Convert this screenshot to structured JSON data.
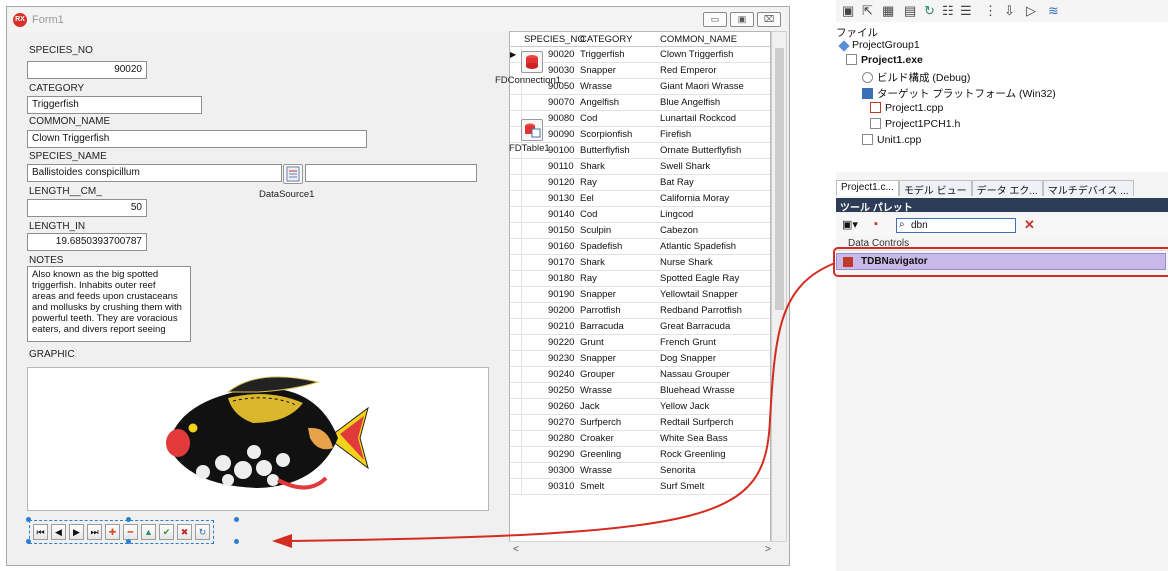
{
  "form": {
    "title": "Form1",
    "app_icon_text": "RX",
    "window_buttons": {
      "minimize": "▭",
      "maximize": "▣",
      "close": "⌧"
    },
    "fields": {
      "species_no": {
        "label": "SPECIES_NO",
        "value": "90020"
      },
      "category": {
        "label": "CATEGORY",
        "value": "Triggerfish"
      },
      "common_name": {
        "label": "COMMON_NAME",
        "value": "Clown Triggerfish"
      },
      "species_name": {
        "label": "SPECIES_NAME",
        "value": "Ballistoides conspicillum"
      },
      "length_cm": {
        "label": "LENGTH__CM_",
        "value": "50"
      },
      "length_in": {
        "label": "LENGTH_IN",
        "value": "19.6850393700787"
      },
      "notes": {
        "label": "NOTES",
        "value": "Also known as the big spotted\ntriggerfish.  Inhabits outer reef\nareas and feeds upon crustaceans\nand mollusks by crushing them with\npowerful teeth.  They are voracious\neaters, and divers report seeing"
      },
      "graphic": {
        "label": "GRAPHIC"
      }
    },
    "components": {
      "datasource": "DataSource1",
      "connection": "FDConnection1",
      "table": "FDTable1"
    },
    "navigator_buttons": [
      "⏮",
      "◀",
      "▶",
      "⏭",
      "✚",
      "━",
      "▲",
      "✔",
      "✖",
      "↻"
    ],
    "grid": {
      "columns": [
        "SPECIES_NO",
        "CATEGORY",
        "COMMON_NAME"
      ],
      "rows": [
        [
          "90020",
          "Triggerfish",
          "Clown Triggerfish"
        ],
        [
          "90030",
          "Snapper",
          "Red Emperor"
        ],
        [
          "90050",
          "Wrasse",
          "Giant Maori Wrasse"
        ],
        [
          "90070",
          "Angelfish",
          "Blue Angelfish"
        ],
        [
          "90080",
          "Cod",
          "Lunartail Rockcod"
        ],
        [
          "90090",
          "Scorpionfish",
          "Firefish"
        ],
        [
          "90100",
          "Butterflyfish",
          "Ornate Butterflyfish"
        ],
        [
          "90110",
          "Shark",
          "Swell Shark"
        ],
        [
          "90120",
          "Ray",
          "Bat Ray"
        ],
        [
          "90130",
          "Eel",
          "California Moray"
        ],
        [
          "90140",
          "Cod",
          "Lingcod"
        ],
        [
          "90150",
          "Sculpin",
          "Cabezon"
        ],
        [
          "90160",
          "Spadefish",
          "Atlantic Spadefish"
        ],
        [
          "90170",
          "Shark",
          "Nurse Shark"
        ],
        [
          "90180",
          "Ray",
          "Spotted Eagle Ray"
        ],
        [
          "90190",
          "Snapper",
          "Yellowtail Snapper"
        ],
        [
          "90200",
          "Parrotfish",
          "Redband Parrotfish"
        ],
        [
          "90210",
          "Barracuda",
          "Great Barracuda"
        ],
        [
          "90220",
          "Grunt",
          "French Grunt"
        ],
        [
          "90230",
          "Snapper",
          "Dog Snapper"
        ],
        [
          "90240",
          "Grouper",
          "Nassau Grouper"
        ],
        [
          "90250",
          "Wrasse",
          "Bluehead Wrasse"
        ],
        [
          "90260",
          "Jack",
          "Yellow Jack"
        ],
        [
          "90270",
          "Surfperch",
          "Redtail Surfperch"
        ],
        [
          "90280",
          "Croaker",
          "White Sea Bass"
        ],
        [
          "90290",
          "Greenling",
          "Rock Greenling"
        ],
        [
          "90300",
          "Wrasse",
          "Senorita"
        ],
        [
          "90310",
          "Smelt",
          "Surf Smelt"
        ]
      ]
    }
  },
  "ide": {
    "project_tree": {
      "file_label": "ファイル",
      "group": "ProjectGroup1",
      "project": "Project1.exe",
      "build_config": "ビルド構成 (Debug)",
      "target_platform": "ターゲット プラットフォーム (Win32)",
      "files": [
        "Project1.cpp",
        "Project1PCH1.h",
        "Unit1.cpp"
      ]
    },
    "tabs": [
      "Project1.c...",
      "モデル ビュー",
      "データ エク...",
      "マルチデバイス ..."
    ],
    "palette": {
      "title": "ツール パレット",
      "search_value": "dbn",
      "category": "Data Controls",
      "item": "TDBNavigator"
    }
  },
  "colors": {
    "highlight": "#d42c1f",
    "palette_header": "#2e3d57",
    "palette_item_bg": "#c9b9e8",
    "selection_handles": "#2a7fd0"
  }
}
